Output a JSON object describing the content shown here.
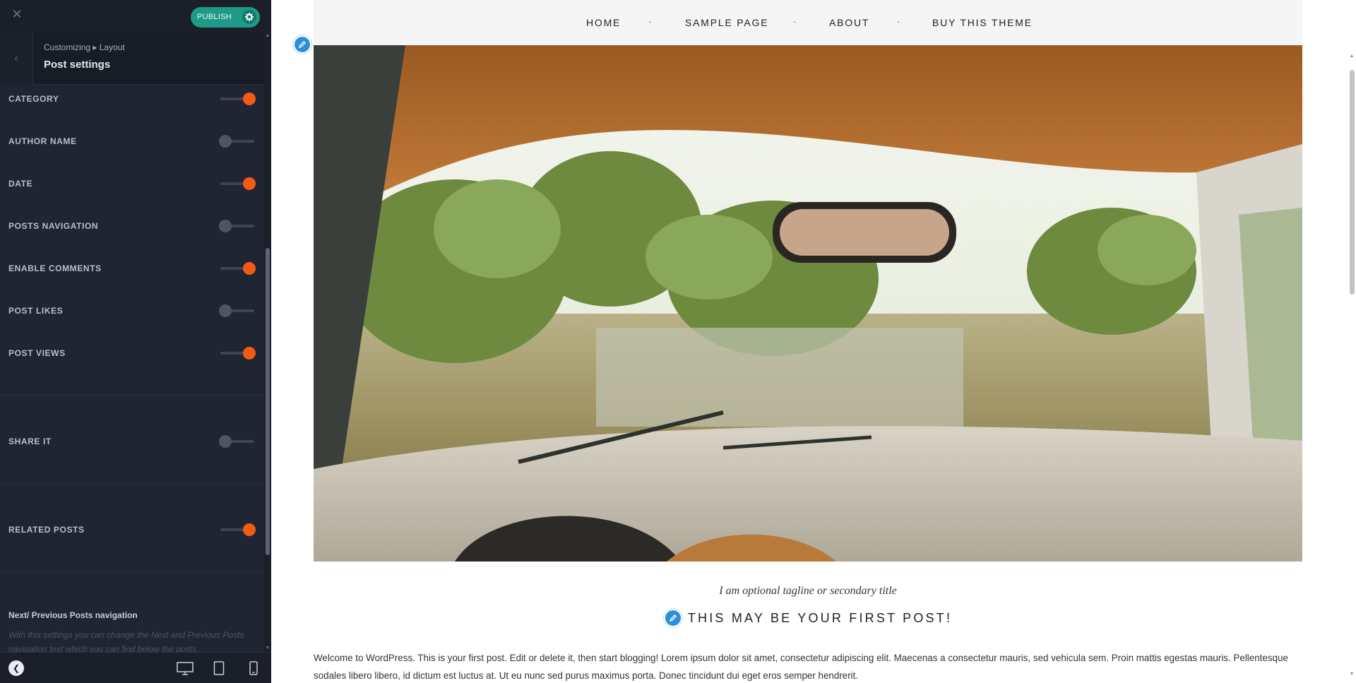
{
  "sidebar": {
    "close_icon": "close-icon",
    "publish_label": "PUBLISH",
    "breadcrumb": "Customizing ▸ Layout",
    "section_title": "Post settings",
    "options": [
      {
        "label": "CATEGORY",
        "enabled": true
      },
      {
        "label": "AUTHOR NAME",
        "enabled": false
      },
      {
        "label": "DATE",
        "enabled": true
      },
      {
        "label": "POSTS NAVIGATION",
        "enabled": false
      },
      {
        "label": "ENABLE COMMENTS",
        "enabled": true
      },
      {
        "label": "POST LIKES",
        "enabled": false
      },
      {
        "label": "POST VIEWS",
        "enabled": true
      },
      {
        "label": "SHARE IT",
        "enabled": false
      },
      {
        "label": "RELATED POSTS",
        "enabled": true
      }
    ],
    "nav_description_title": "Next/ Previous Posts navigation",
    "nav_description": "With this settings you can change the Next and Previous Posts navigation text which you can find below the posts.",
    "toggle_on_color": "#f55a14",
    "toggle_off_color": "#4f5566",
    "publish_color": "#1f9a87"
  },
  "footer": {
    "collapse_icon": "chevron-left-icon",
    "devices": [
      "desktop-icon",
      "tablet-icon",
      "mobile-icon"
    ]
  },
  "preview": {
    "nav": {
      "items": [
        "HOME",
        "SAMPLE PAGE",
        "ABOUT",
        "BUY THIS THEME"
      ],
      "separator": "·"
    },
    "tagline": "I am optional tagline or secondary title",
    "post_title": "THIS MAY BE YOUR FIRST POST!",
    "post_body": "Welcome to WordPress. This is your first post. Edit or delete it, then start blogging! Lorem ipsum dolor sit amet, consectetur adipiscing elit. Maecenas a consectetur mauris, sed vehicula sem. Proin mattis egestas mauris. Pellentesque sodales libero libero, id dictum est luctus at. Ut eu nunc sed purus maximus porta. Donec tincidunt dui eget eros semper hendrerit."
  }
}
